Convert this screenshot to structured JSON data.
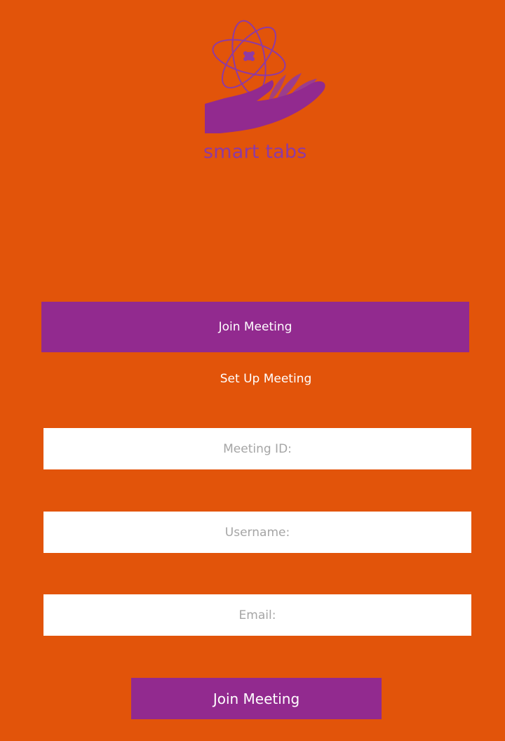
{
  "brand": {
    "name": "smart tabs",
    "icon": "atom-hand-logo",
    "color": "#8e3aa4"
  },
  "colors": {
    "background": "#e2540a",
    "accent": "#922a8f",
    "field_background": "#ffffff",
    "placeholder": "#a5a5a5"
  },
  "tabs": {
    "join_label": "Join Meeting",
    "setup_label": "Set Up Meeting"
  },
  "form": {
    "meeting_id_placeholder": "Meeting ID:",
    "username_placeholder": "Username:",
    "email_placeholder": "Email:",
    "submit_label": "Join Meeting"
  }
}
